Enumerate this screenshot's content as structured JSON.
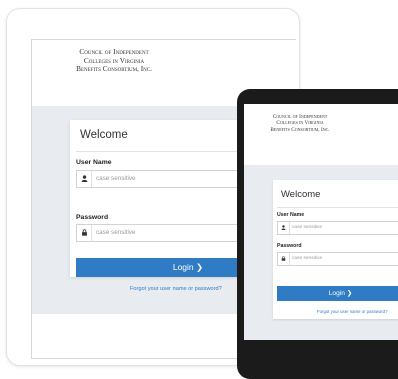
{
  "brand": {
    "line1": "Council of Independent",
    "line2": "Colleges in Virginia",
    "line3": "Benefits Consortium, Inc."
  },
  "login": {
    "title": "Welcome",
    "username_label": "User Name",
    "username_placeholder": "case sensitive",
    "password_label": "Password",
    "password_placeholder": "case sensitive",
    "login_button": "Login",
    "login_chevron": "❯",
    "forgot_link": "Forgot your user name or password?"
  },
  "icons": {
    "user": "user-icon",
    "lock": "lock-icon",
    "chevron": "chevron-right-icon"
  },
  "colors": {
    "accent": "#2f7cc4",
    "band": "#e8ebef"
  }
}
